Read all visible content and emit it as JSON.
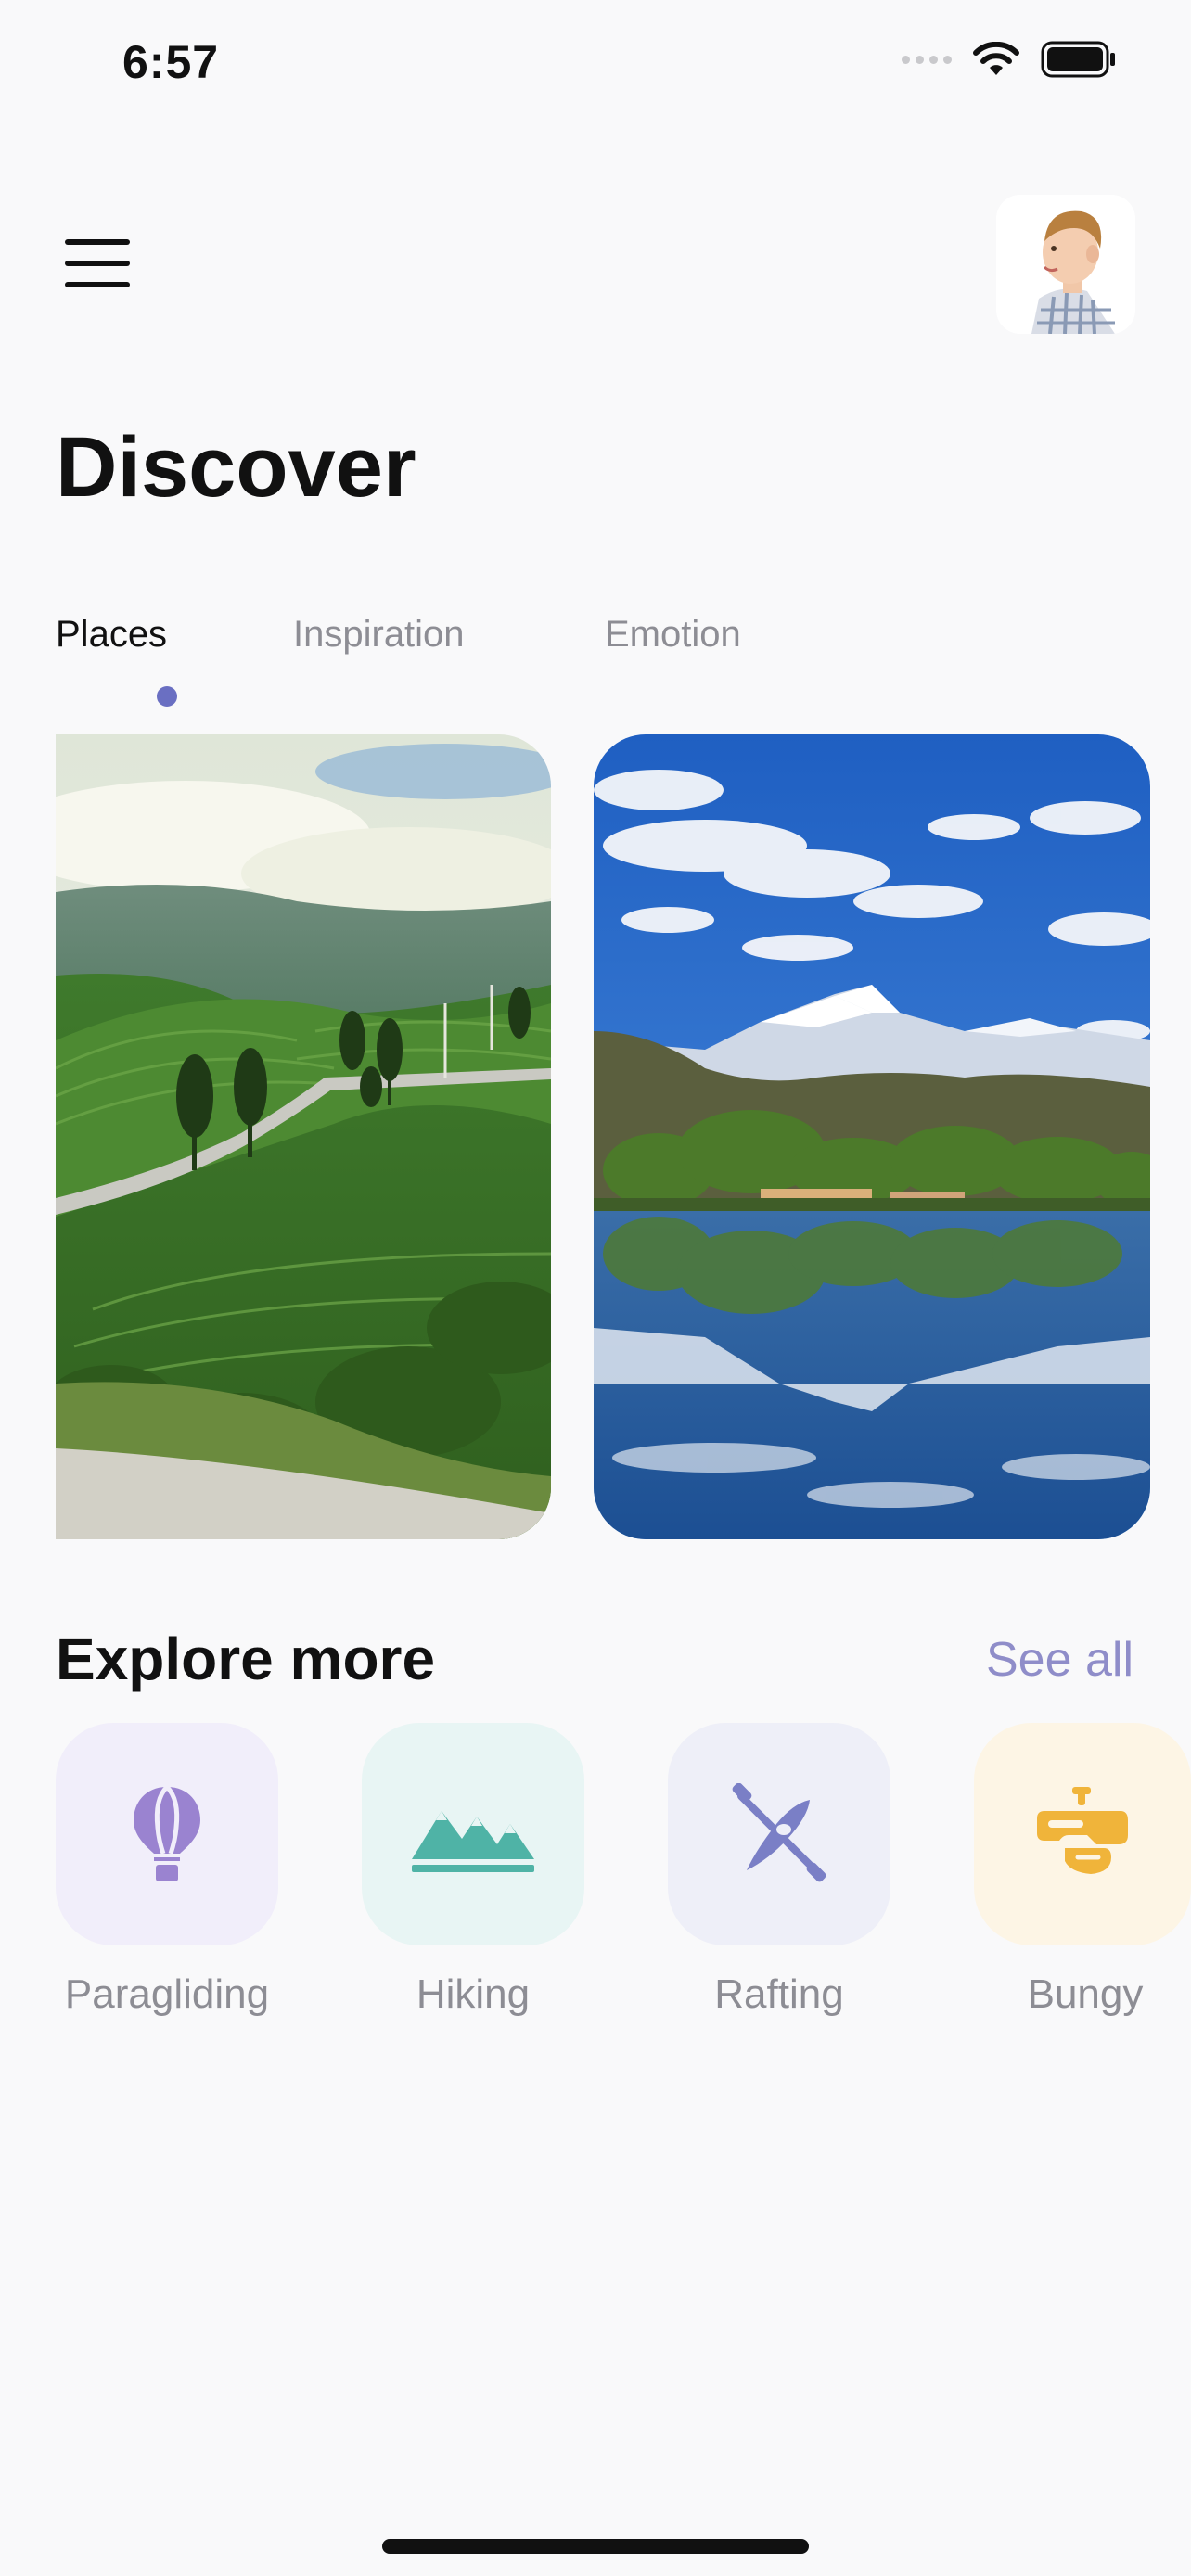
{
  "status_bar": {
    "time": "6:57",
    "icons": [
      "signal-dots-icon",
      "wifi-icon",
      "battery-icon"
    ]
  },
  "header": {
    "menu_icon": "hamburger-menu-icon",
    "avatar_description": "profile-photo"
  },
  "page": {
    "title": "Discover"
  },
  "tabs": [
    {
      "label": "Places",
      "active": true
    },
    {
      "label": "Inspiration",
      "active": false
    },
    {
      "label": "Emotion",
      "active": false
    }
  ],
  "cards": [
    {
      "image": "tea-plantation-hills"
    },
    {
      "image": "mountain-lake-reflection"
    }
  ],
  "explore": {
    "title": "Explore more",
    "see_all": "See all",
    "categories": [
      {
        "label": "Paragliding",
        "icon": "hot-air-balloon-icon",
        "color": "#9a83d0",
        "bg": "#f1eefa"
      },
      {
        "label": "Hiking",
        "icon": "mountains-icon",
        "color": "#4fb3a6",
        "bg": "#e8f5f4"
      },
      {
        "label": "Rafting",
        "icon": "kayak-paddle-icon",
        "color": "#7a7fc6",
        "bg": "#eeeff8"
      },
      {
        "label": "Bungy",
        "icon": "bungy-icon",
        "color": "#f0b43a",
        "bg": "#fdf5e5"
      }
    ]
  },
  "colors": {
    "accent": "#6a6fc2",
    "see_all": "#8f8dc9",
    "background": "#f9f9fa"
  }
}
